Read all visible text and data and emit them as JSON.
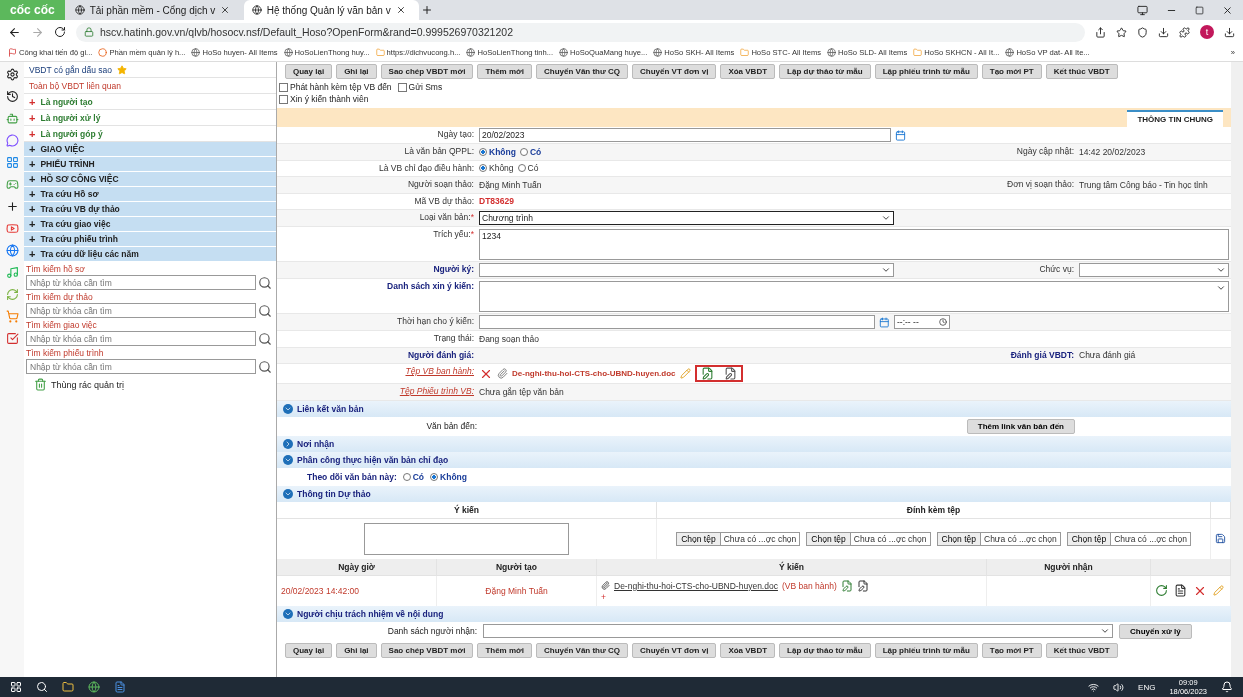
{
  "browser": {
    "brand": "cốc cốc",
    "tabs": [
      {
        "title": "Tải phần mềm - Cổng dịch v",
        "selected": false
      },
      {
        "title": "Hệ thống Quản lý văn bản v",
        "selected": true
      }
    ],
    "url": "hscv.hatinh.gov.vn/qlvb/hosocv.nsf/Default_Hoso?OpenForm&rand=0.999526970321202",
    "bookmarks": [
      {
        "label": "Công khai tiến độ gi...",
        "kind": "flag"
      },
      {
        "label": "Phần mềm quản lý h...",
        "kind": "dot"
      },
      {
        "label": "HoSo huyen- All Items",
        "kind": "globe"
      },
      {
        "label": "HoSoLienThong huy...",
        "kind": "globe"
      },
      {
        "label": "https://dichvucong.h...",
        "kind": "folder"
      },
      {
        "label": "HoSoLienThong tinh...",
        "kind": "globe"
      },
      {
        "label": "HoSoQuaMang huye...",
        "kind": "globe"
      },
      {
        "label": "HoSo SKH- All Items",
        "kind": "globe"
      },
      {
        "label": "HoSo STC- All Items",
        "kind": "folder"
      },
      {
        "label": "HoSo SLD- All Items",
        "kind": "globe"
      },
      {
        "label": "HoSo SKHCN - All It...",
        "kind": "folder"
      },
      {
        "label": "HoSo VP dat- All Ite...",
        "kind": "globe"
      }
    ],
    "more": "»",
    "profile": "t"
  },
  "sidebar": {
    "items": [
      {
        "label": "VBDT có gắn dấu sao",
        "kind": "starred"
      },
      {
        "label": "Toàn bộ VBDT liên quan",
        "kind": "link"
      },
      {
        "label": "Là người tạo",
        "kind": "role"
      },
      {
        "label": "Là người xử lý",
        "kind": "role"
      },
      {
        "label": "Là người góp ý",
        "kind": "role"
      },
      {
        "label": "GIAO VIỆC",
        "kind": "group"
      },
      {
        "label": "PHIẾU TRÌNH",
        "kind": "group"
      },
      {
        "label": "HỒ SƠ CÔNG VIỆC",
        "kind": "group"
      },
      {
        "label": "Tra cứu Hồ sơ",
        "kind": "group"
      },
      {
        "label": "Tra cứu VB dự thảo",
        "kind": "group"
      },
      {
        "label": "Tra cứu giao việc",
        "kind": "group"
      },
      {
        "label": "Tra cứu phiếu trình",
        "kind": "group"
      },
      {
        "label": "Tra cứu dữ liệu các năm",
        "kind": "group"
      }
    ],
    "marker": "+",
    "searches": [
      {
        "title": "Tìm kiếm hồ sơ",
        "placeholder": "Nhập từ khóa cần tìm"
      },
      {
        "title": "Tìm kiếm dự thảo",
        "placeholder": "Nhập từ khóa cần tìm"
      },
      {
        "title": "Tìm kiếm giao việc",
        "placeholder": "Nhập từ khóa cần tìm"
      },
      {
        "title": "Tìm kiếm phiếu trình",
        "placeholder": "Nhập từ khóa cần tìm"
      }
    ],
    "trash": "Thùng rác quản trị"
  },
  "toolbar_top": [
    "Quay lại",
    "Ghi lại",
    "Sao chép VBDT mới",
    "Thêm mới",
    "Chuyển Văn thư CQ",
    "Chuyển VT đơn vị",
    "Xóa VBDT",
    "Lập dự thảo từ mẫu",
    "Lập phiếu trình từ mẫu",
    "Tạo mới PT",
    "Kết thúc VBDT"
  ],
  "options": [
    [
      {
        "label": "Phát hành kèm tệp VB đến",
        "checked": false
      },
      {
        "label": "Gửi Sms",
        "checked": false
      }
    ],
    [
      {
        "label": "Xin ý kiến thành viên",
        "checked": false
      }
    ]
  ],
  "form_tab": {
    "label": "THÔNG TIN CHUNG",
    "selected": true
  },
  "rows": [
    {
      "kind": "date",
      "label": "Ngày tạo:",
      "value": "20/02/2023"
    },
    {
      "kind": "radio",
      "label": "Là văn bản QPPL:",
      "bold_options": true,
      "options": [
        {
          "label": "Không",
          "selected": true
        },
        {
          "label": "Có",
          "selected": false
        }
      ],
      "right_label": "Ngày cập nhật:",
      "right_value": "14:42 20/02/2023"
    },
    {
      "kind": "radio",
      "label": "Là VB chỉ đạo điều hành:",
      "bold_options": false,
      "options": [
        {
          "label": "Không",
          "selected": true
        },
        {
          "label": "Có",
          "selected": false
        }
      ]
    },
    {
      "kind": "text",
      "label": "Người soạn thảo:",
      "value": "Đặng Minh Tuấn",
      "right_label": "Đơn vị soạn thảo:",
      "right_value": "Trung tâm Công báo - Tin học tỉnh"
    },
    {
      "kind": "code",
      "label": "Mã VB dự thảo:",
      "value": "DT83629"
    },
    {
      "kind": "select",
      "label": "Loại văn bản:",
      "required": "*",
      "value": "Chương trình"
    },
    {
      "kind": "textarea",
      "label": "Trích yếu:",
      "required": "*",
      "value": "1234"
    },
    {
      "kind": "signer",
      "label": "Người ký:",
      "right_label": "Chức vụ:"
    },
    {
      "kind": "multiselect",
      "label": "Danh sách xin ý kiến:"
    },
    {
      "kind": "datetime",
      "label": "Thời hạn cho ý kiến:",
      "time": "--:-- --"
    },
    {
      "kind": "text",
      "label": "Trạng thái:",
      "value": "Đang soạn thảo"
    },
    {
      "kind": "review",
      "label": "Người đánh giá:",
      "right_label": "Đánh giá VBDT:",
      "right_value": "Chưa đánh giá"
    },
    {
      "kind": "file",
      "label": "Tệp VB ban hành:",
      "value": "De-nghi-thu-hoi-CTS-cho-UBND-huyen.doc"
    },
    {
      "kind": "file-status",
      "label": "Tệp Phiếu trình VB:",
      "value": "Chưa gắn tệp văn bản"
    }
  ],
  "links_section": {
    "title": "Liên kết văn bản",
    "expanded": true,
    "label": "Văn bản đến:",
    "button": "Thêm link văn bản đến"
  },
  "recipients_section": {
    "title": "Nơi nhận",
    "expanded": false
  },
  "assign_section": {
    "title": "Phân công thực hiện văn bản chỉ đạo",
    "expanded": true,
    "label": "Theo dõi văn bản này:",
    "options": [
      {
        "label": "Có",
        "selected": false
      },
      {
        "label": "Không",
        "selected": true
      }
    ]
  },
  "draft_section": {
    "title": "Thông tin Dự thảo",
    "expanded": true,
    "columns": [
      "Ý kiến",
      "Đính kèm tệp"
    ],
    "files": [
      {
        "button": "Chọn tệp",
        "status": "Chưa có ...ợc chọn"
      },
      {
        "button": "Chọn tệp",
        "status": "Chưa có ...ợc chọn"
      },
      {
        "button": "Chọn tệp",
        "status": "Chưa có ...ợc chọn"
      },
      {
        "button": "Chọn tệp",
        "status": "Chưa có ...ợc chọn"
      }
    ]
  },
  "history": {
    "columns": [
      "Ngày giờ",
      "Người tạo",
      "Ý kiến",
      "Người nhận"
    ],
    "rows": [
      {
        "time": "20/02/2023 14:42:00",
        "author": "Đặng Minh Tuấn",
        "file": "De-nghi-thu-hoi-CTS-cho-UBND-huyen.doc",
        "note": "(VB ban hành)",
        "mark": "+"
      }
    ]
  },
  "owner_section": {
    "title": "Người chịu trách nhiệm về nội dung",
    "expanded": true,
    "label": "Danh sách người nhận:",
    "button": "Chuyển xử lý"
  },
  "toolbar_bottom": [
    "Quay lại",
    "Ghi lại",
    "Sao chép VBDT mới",
    "Thêm mới",
    "Chuyển Văn thư CQ",
    "Chuyển VT đơn vị",
    "Xóa VBDT",
    "Lập dự thảo từ mẫu",
    "Lập phiếu trình từ mẫu",
    "Tạo mới PT",
    "Kết thúc VBDT"
  ],
  "taskbar": {
    "language": "ENG",
    "time": "09:09",
    "date": "18/06/2023"
  }
}
